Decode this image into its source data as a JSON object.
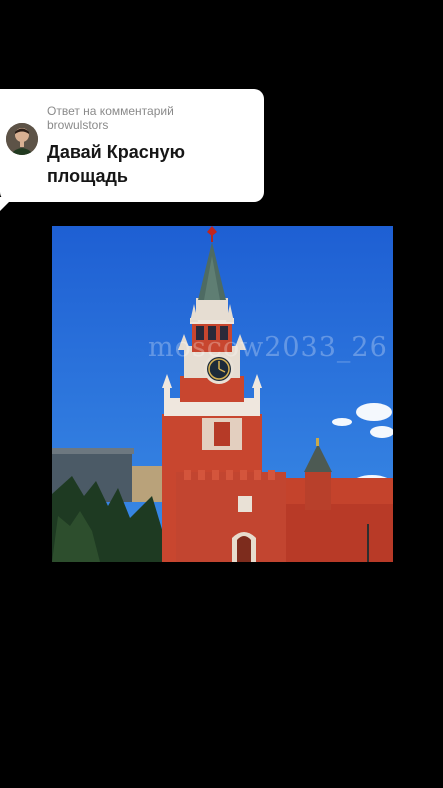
{
  "reply": {
    "title": "Ответ на комментарий",
    "username": "browulstors",
    "comment": "Давай Красную площадь"
  },
  "video": {
    "watermark": "moscow2033_26"
  },
  "colors": {
    "background": "#000000",
    "bubble": "#ffffff",
    "sky": "#1f66d6",
    "brick": "#c4432c"
  }
}
